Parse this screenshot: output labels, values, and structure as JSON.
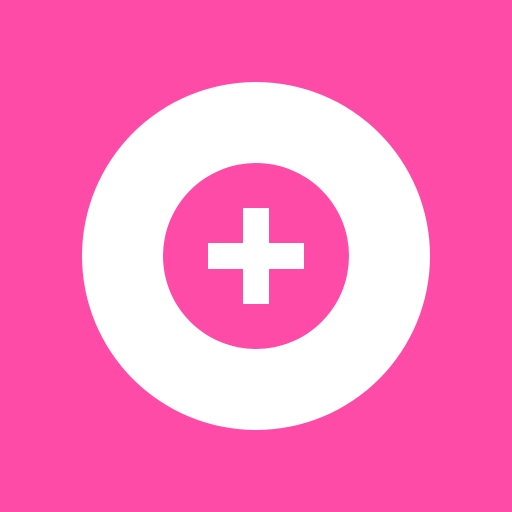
{
  "icon": {
    "name": "add-circle-icon",
    "background_color": "#ff4ba8",
    "ring_color": "#ffffff",
    "glyph_color": "#ffffff"
  }
}
